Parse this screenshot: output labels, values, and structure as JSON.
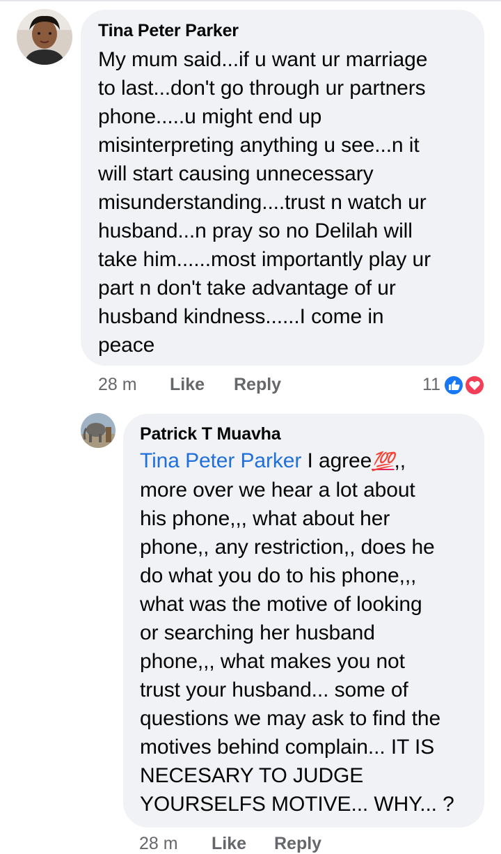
{
  "comments": [
    {
      "author": "Tina Peter Parker",
      "text": "My mum said...if u want ur marriage to last...don't go through ur partners phone.....u might end up misinterpreting anything u see...n it will start causing unnecessary misunderstanding....trust n watch ur husband...n pray so no Delilah will take him......most importantly play ur part n don't take advantage of ur husband kindness......I come in peace",
      "lines": [
        "My mum said...if u want ur marriage",
        "to last...don't go through ur partners",
        "phone.....u might end up",
        "misinterpreting anything u see...n it",
        "will start causing unnecessary",
        "misunderstanding....trust n watch ur",
        "husband...n pray so no Delilah will",
        "take him......most importantly play ur",
        "part n don't take advantage of ur",
        "husband kindness......I come in",
        "peace"
      ],
      "time": "28 m",
      "like_label": "Like",
      "reply_label": "Reply",
      "reaction_count": "11",
      "reaction_icons": [
        "thumbs-up-icon",
        "heart-icon"
      ]
    },
    {
      "author": "Patrick T Muavha",
      "mention": "Tina Peter Parker",
      "first_line_rest": " I agree",
      "emoji": "💯",
      "first_line_tail": ",,",
      "lines": [
        "more over we hear a lot about",
        "his phone,,, what about her",
        "phone,, any restriction,, does he",
        "do what you do to his phone,,,",
        "what was the motive of looking",
        "or searching her husband",
        "phone,,, what makes you not",
        "trust your husband... some of",
        "questions we may ask to find the",
        "motives behind complain... IT IS",
        "NECESARY TO JUDGE",
        "YOURSELFS MOTIVE... WHY... ?"
      ],
      "time": "28 m",
      "like_label": "Like",
      "reply_label": "Reply"
    }
  ],
  "colors": {
    "bubble": "#f0f2f5",
    "meta": "#65676b",
    "mention": "#216fdb",
    "like_reaction": "#1877f2",
    "love_reaction": "#f33e58"
  }
}
